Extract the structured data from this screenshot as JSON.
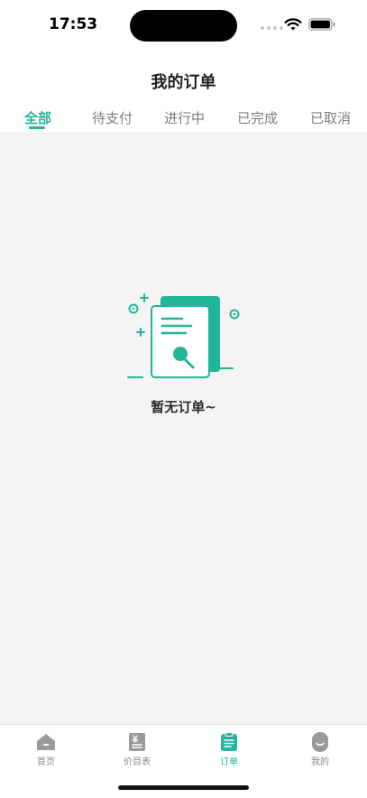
{
  "status_bar": {
    "time": "17:53"
  },
  "header": {
    "title": "我的订单"
  },
  "tabs": [
    {
      "label": "全部",
      "active": true
    },
    {
      "label": "待支付"
    },
    {
      "label": "进行中"
    },
    {
      "label": "已完成"
    },
    {
      "label": "已取消"
    }
  ],
  "empty_state": {
    "message": "暂无订单~",
    "icon": "document-search-icon"
  },
  "tabbar": [
    {
      "label": "首页",
      "icon": "home-icon"
    },
    {
      "label": "价目表",
      "icon": "price-list-icon"
    },
    {
      "label": "订单",
      "icon": "orders-icon",
      "active": true
    },
    {
      "label": "我的",
      "icon": "profile-icon"
    }
  ],
  "colors": {
    "accent": "#21b59a",
    "background": "#f4f4f4",
    "inactive": "#888888"
  }
}
